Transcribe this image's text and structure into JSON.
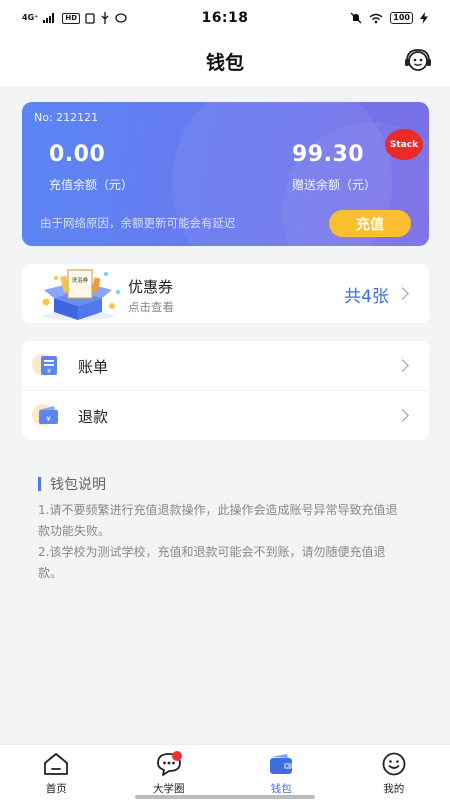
{
  "status_bar": {
    "signal": "4G⁺",
    "hd_badge": "HD",
    "time": "16:18",
    "battery": "100"
  },
  "header": {
    "title": "钱包",
    "service_icon": "customer-service-icon"
  },
  "wallet_card": {
    "card_no": "No: 212121",
    "recharge_balance": "0.00",
    "recharge_balance_label": "充值余额（元）",
    "gift_balance": "99.30",
    "gift_balance_label": "赠送余额（元）",
    "stack_badge": "Stack",
    "note": "由于网络原因，余额更新可能会有延迟",
    "recharge_button": "充值",
    "colors": {
      "gradient_start": "#5b86f5",
      "gradient_end": "#7b6ee6",
      "button": "#f9bf2e",
      "badge": "#ec2a2a"
    }
  },
  "coupon": {
    "image_text": "洗浴券",
    "title": "优惠券",
    "subtitle": "点击查看",
    "count_text": "共4张"
  },
  "menu": {
    "items": [
      {
        "label": "账单",
        "icon": "bill-icon"
      },
      {
        "label": "退款",
        "icon": "refund-wallet-icon"
      }
    ]
  },
  "notes": {
    "title": "钱包说明",
    "lines": [
      "1.请不要频繁进行充值退款操作，此操作会造成账号异常导致充值退款功能失败。",
      "2.该学校为测试学校，充值和退款可能会不到账，请勿随便充值退款。"
    ]
  },
  "tab_bar": {
    "active_index": 2,
    "accent": "#3e6ee0",
    "tabs": [
      {
        "label": "首页",
        "icon": "home-icon"
      },
      {
        "label": "大学圈",
        "icon": "chat-bubble-icon"
      },
      {
        "label": "钱包",
        "icon": "wallet-icon"
      },
      {
        "label": "我的",
        "icon": "profile-icon"
      }
    ]
  }
}
